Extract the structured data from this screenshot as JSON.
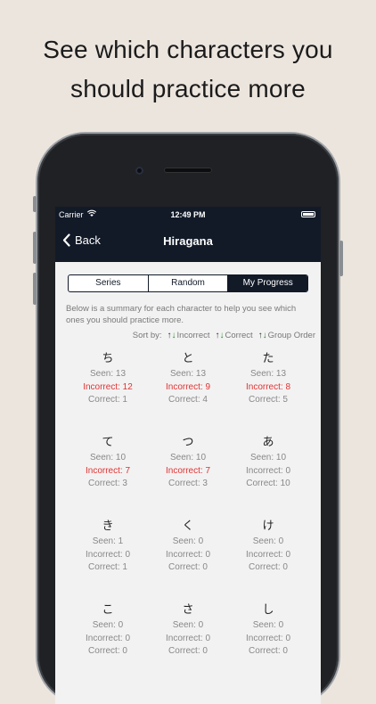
{
  "headline": [
    "See which characters you",
    "should practice more"
  ],
  "status": {
    "carrier": "Carrier",
    "time": "12:49 PM"
  },
  "nav": {
    "back_label": "Back",
    "title": "Hiragana"
  },
  "tabs": [
    {
      "label": "Series",
      "active": false
    },
    {
      "label": "Random",
      "active": false
    },
    {
      "label": "My Progress",
      "active": true
    }
  ],
  "summary": "Below is a summary for each character to help you see which ones you should practice more.",
  "sort": {
    "label": "Sort by:",
    "options": [
      "Incorrect",
      "Correct",
      "Group Order"
    ]
  },
  "colors": {
    "nav": "#121a28",
    "incorrect_highlight": "#e03333"
  },
  "characters": [
    {
      "char": "ち",
      "seen": "Seen: 13",
      "incorrect": "Incorrect: 12",
      "correct": "Correct: 1",
      "highlight": true
    },
    {
      "char": "と",
      "seen": "Seen: 13",
      "incorrect": "Incorrect: 9",
      "correct": "Correct: 4",
      "highlight": true
    },
    {
      "char": "た",
      "seen": "Seen: 13",
      "incorrect": "Incorrect: 8",
      "correct": "Correct: 5",
      "highlight": true
    },
    {
      "char": "て",
      "seen": "Seen: 10",
      "incorrect": "Incorrect: 7",
      "correct": "Correct: 3",
      "highlight": true
    },
    {
      "char": "つ",
      "seen": "Seen: 10",
      "incorrect": "Incorrect: 7",
      "correct": "Correct: 3",
      "highlight": true
    },
    {
      "char": "あ",
      "seen": "Seen: 10",
      "incorrect": "Incorrect: 0",
      "correct": "Correct: 10",
      "highlight": false
    },
    {
      "char": "き",
      "seen": "Seen: 1",
      "incorrect": "Incorrect: 0",
      "correct": "Correct: 1",
      "highlight": false
    },
    {
      "char": "く",
      "seen": "Seen: 0",
      "incorrect": "Incorrect: 0",
      "correct": "Correct: 0",
      "highlight": false
    },
    {
      "char": "け",
      "seen": "Seen: 0",
      "incorrect": "Incorrect: 0",
      "correct": "Correct: 0",
      "highlight": false
    },
    {
      "char": "こ",
      "seen": "Seen: 0",
      "incorrect": "Incorrect: 0",
      "correct": "Correct: 0",
      "highlight": false
    },
    {
      "char": "さ",
      "seen": "Seen: 0",
      "incorrect": "Incorrect: 0",
      "correct": "Correct: 0",
      "highlight": false
    },
    {
      "char": "し",
      "seen": "Seen: 0",
      "incorrect": "Incorrect: 0",
      "correct": "Correct: 0",
      "highlight": false
    }
  ]
}
